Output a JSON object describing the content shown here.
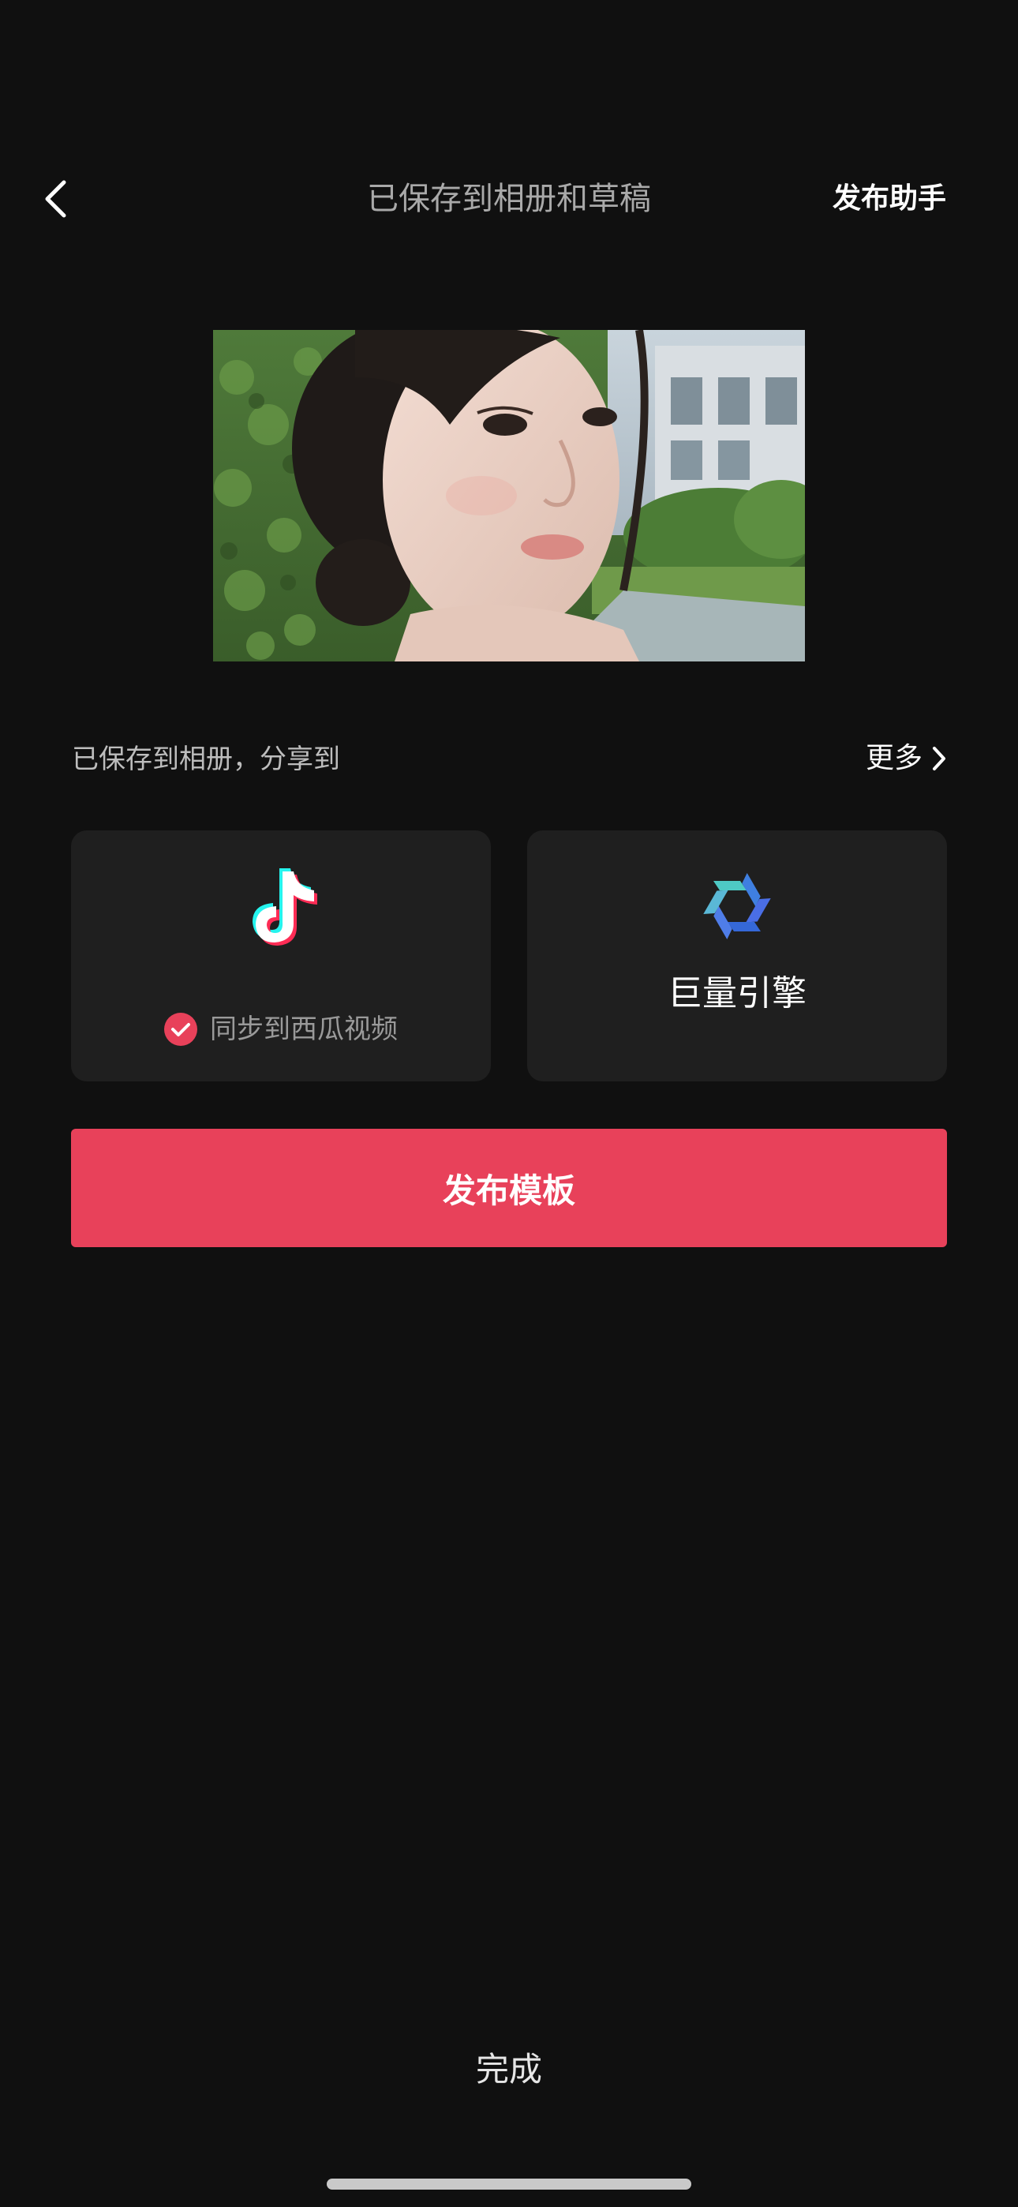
{
  "header": {
    "title": "已保存到相册和草稿",
    "assistant_label": "发布助手"
  },
  "share": {
    "label": "已保存到相册，分享到",
    "more_label": "更多"
  },
  "cards": {
    "douyin": {
      "icon": "douyin-logo-icon",
      "sync_label": "同步到西瓜视频",
      "sync_checked": true
    },
    "juliang": {
      "icon": "juliang-engine-logo-icon",
      "label": "巨量引擎"
    }
  },
  "publish_button_label": "发布模板",
  "done_label": "完成",
  "colors": {
    "background": "#101010",
    "card": "#1f1f1f",
    "accent": "#e8415a",
    "muted_text": "#a9a9a9"
  }
}
